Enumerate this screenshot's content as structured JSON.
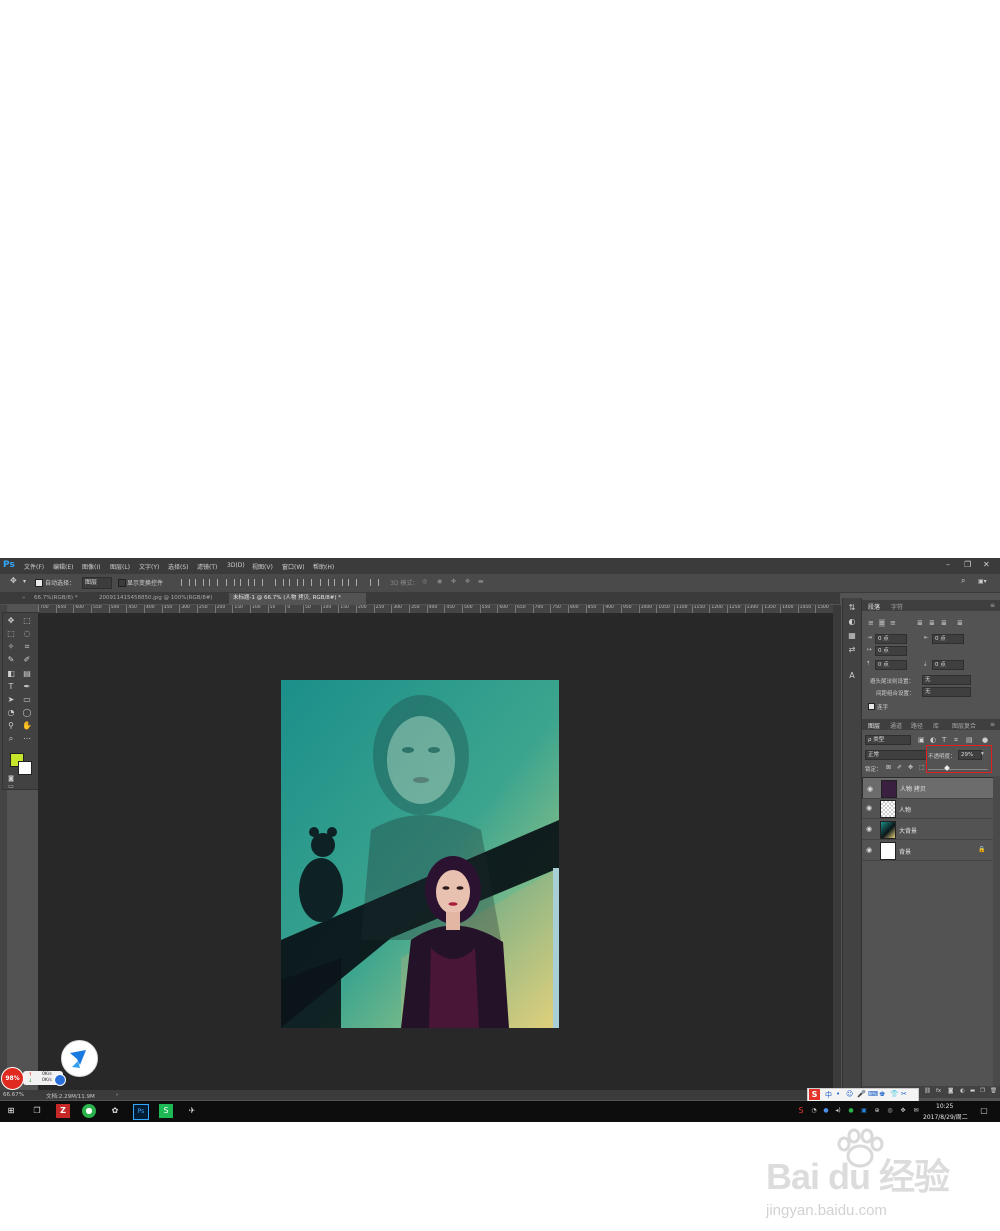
{
  "menubar": {
    "logo": "Ps",
    "items": [
      "文件(F)",
      "编辑(E)",
      "图像(I)",
      "图层(L)",
      "文字(Y)",
      "选择(S)",
      "滤镜(T)",
      "3D(D)",
      "视图(V)",
      "窗口(W)",
      "帮助(H)"
    ]
  },
  "optbar": {
    "auto_select_label": "自动选择：",
    "auto_select_value": "图层",
    "show_transform_label": "显示变换控件",
    "mode_3d_label": "3D 模式："
  },
  "tabs": [
    "66.7%(RGB/8) *",
    "200911415458850.jpg @ 100%(RGB/8#)",
    "未标题-1 @ 66.7% (人物 拷贝, RGB/8#) *"
  ],
  "ruler_labels": [
    "700",
    "650",
    "600",
    "550",
    "500",
    "450",
    "400",
    "350",
    "300",
    "250",
    "200",
    "150",
    "100",
    "50",
    "0",
    "50",
    "100",
    "150",
    "200",
    "250",
    "300",
    "350",
    "400",
    "450",
    "500",
    "550",
    "600",
    "650",
    "700",
    "750",
    "800",
    "850",
    "900",
    "950",
    "1000",
    "1050",
    "1100",
    "1150",
    "1200",
    "1250",
    "1300",
    "1350",
    "1400",
    "1450",
    "1500"
  ],
  "status": {
    "zoom": "66.67%",
    "doc_size": "文档:2.29M/11.9M"
  },
  "paragraph_panel": {
    "tabs": [
      "段落",
      "字符"
    ],
    "fields": [
      "0 点",
      "0 点",
      "0 点",
      "0 点",
      "0 点"
    ],
    "kinsoku_label": "避头尾法则设置：",
    "kinsoku_value": "无",
    "mojikumi_label": "间距组合设置：",
    "mojikumi_value": "无",
    "hyphenate_label": "连字"
  },
  "layers_panel": {
    "tabs": [
      "图层",
      "通道",
      "路径",
      "库",
      "图层复合"
    ],
    "filter_label": "ρ 类型",
    "blend_mode": "正常",
    "opacity_label": "不透明度：",
    "opacity_value": "29%",
    "lock_label": "锁定：",
    "layers": [
      {
        "name": "人物 拷贝",
        "selected": true
      },
      {
        "name": "人物",
        "selected": false
      },
      {
        "name": "大背景",
        "selected": false
      },
      {
        "name": "背景",
        "selected": false
      }
    ]
  },
  "floating_widget": {
    "percent": "98%",
    "up_speed": "0K/s",
    "down_speed": "0K/s"
  },
  "taskbar": {
    "time": "10:25",
    "date": "2017/8/29/周二"
  },
  "ime_bar": {
    "lang": "中"
  },
  "watermark": {
    "brand": "Bai du 经验",
    "url": "jingyan.baidu.com"
  }
}
